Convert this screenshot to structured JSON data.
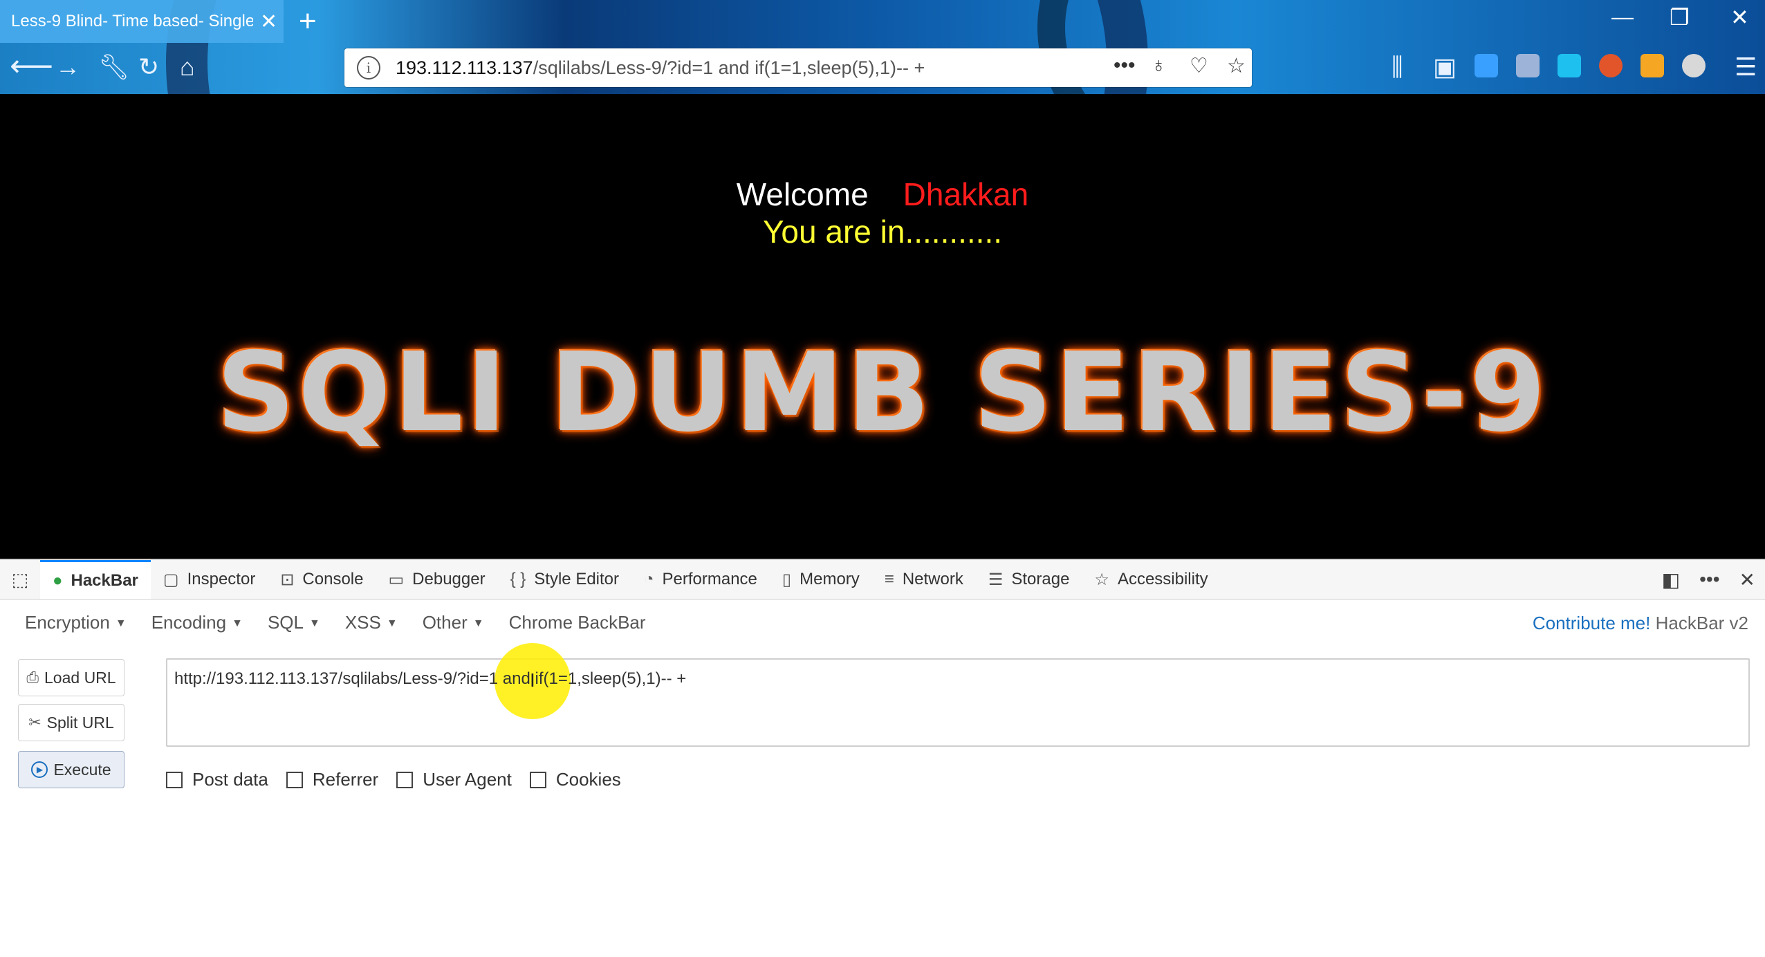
{
  "browser": {
    "tab_title": "Less-9 Blind- Time based- Single",
    "tab_close": "✕",
    "new_tab": "+",
    "url_host": "193.112.113.137",
    "url_path": "/sqlilabs/Less-9/?id=1 and if(1=1,sleep(5),1)-- +",
    "window_controls": [
      "minimize-icon",
      "restore-icon",
      "close-icon"
    ]
  },
  "page": {
    "welcome": "Welcome",
    "name": "Dhakkan",
    "status": "You are in...........",
    "banner": "SQLI DUMB SERIES-9"
  },
  "devtools": {
    "tabs": [
      {
        "label": "HackBar",
        "icon": "hackbar-icon"
      },
      {
        "label": "Inspector",
        "icon": "inspector-icon"
      },
      {
        "label": "Console",
        "icon": "console-icon"
      },
      {
        "label": "Debugger",
        "icon": "debugger-icon"
      },
      {
        "label": "Style Editor",
        "icon": "braces-icon"
      },
      {
        "label": "Performance",
        "icon": "performance-icon"
      },
      {
        "label": "Memory",
        "icon": "memory-icon"
      },
      {
        "label": "Network",
        "icon": "network-icon"
      },
      {
        "label": "Storage",
        "icon": "storage-icon"
      },
      {
        "label": "Accessibility",
        "icon": "accessibility-icon"
      }
    ]
  },
  "hackbar": {
    "menus": [
      "Encryption",
      "Encoding",
      "SQL",
      "XSS",
      "Other"
    ],
    "chrome_backbar": "Chrome BackBar",
    "contribute": "Contribute me!",
    "version": "HackBar v2",
    "load_url": "Load URL",
    "split_url": "Split URL",
    "execute": "Execute",
    "url_value": "http://193.112.113.137/sqlilabs/Less-9/?id=1 and if(1=1,sleep(5),1)-- +",
    "options": [
      "Post data",
      "Referrer",
      "User Agent",
      "Cookies"
    ]
  },
  "colors": {
    "welcome_name": "#ff1c1c",
    "status_text": "#ffff33",
    "banner_glow": "#ff6a00",
    "link": "#1a6fbf"
  }
}
